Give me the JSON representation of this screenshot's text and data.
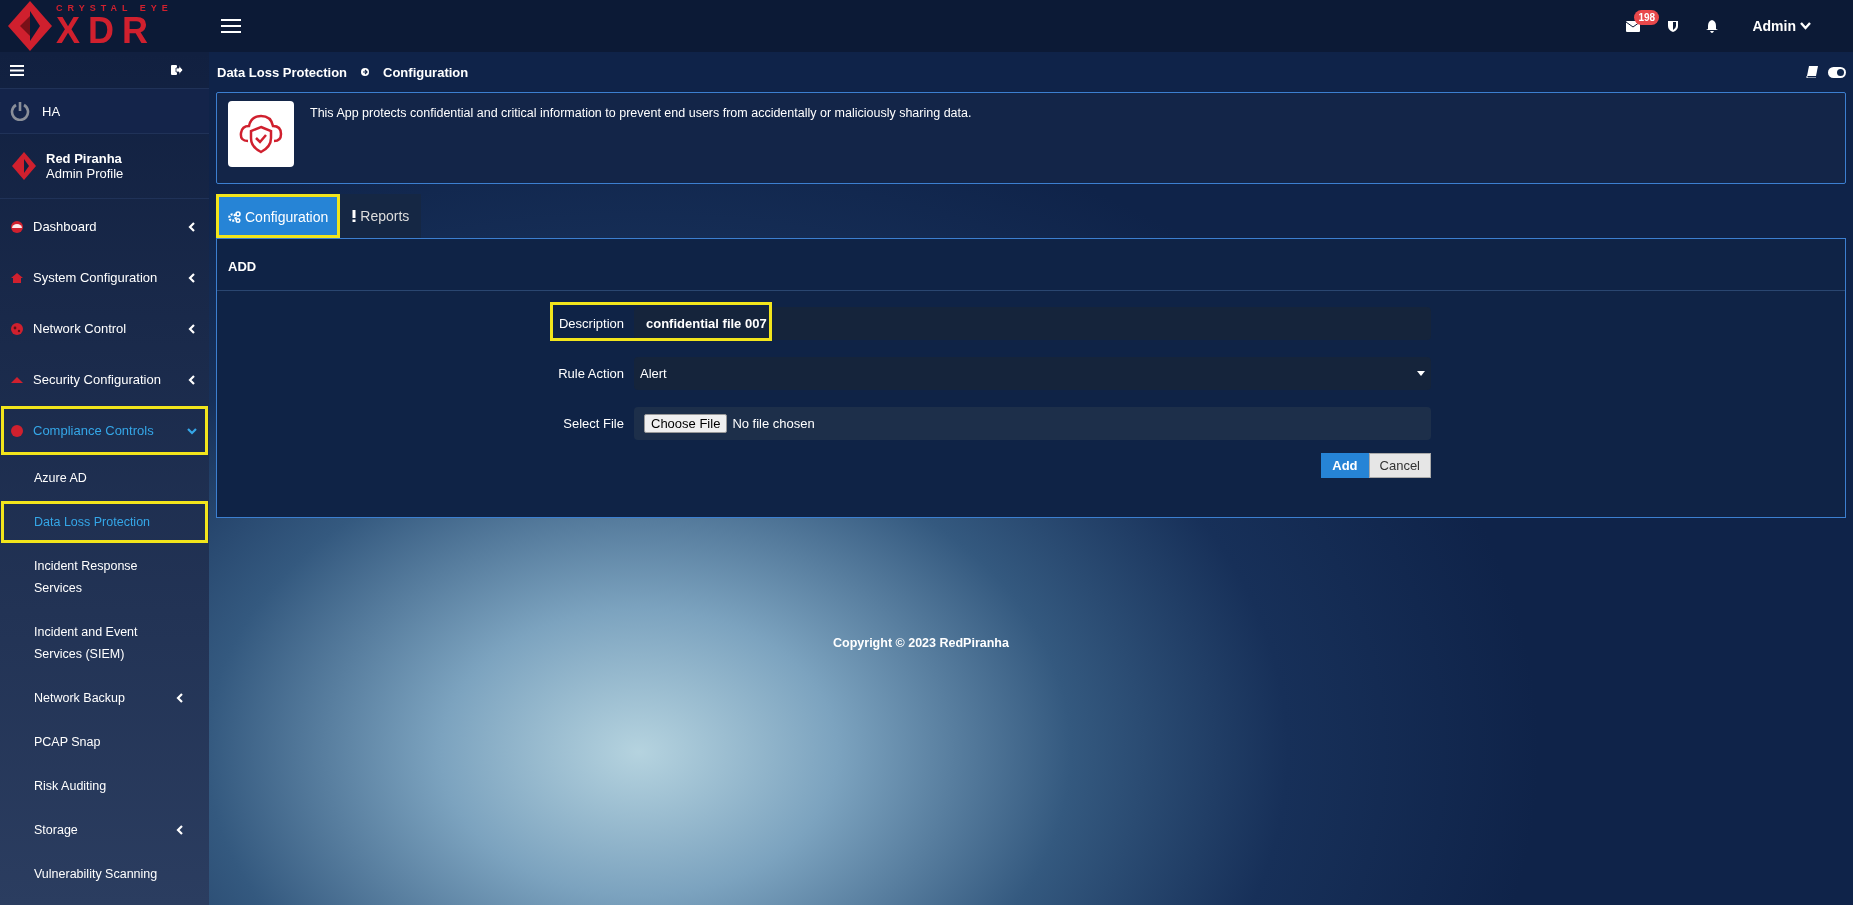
{
  "header": {
    "logo_top": "CRYSTAL EYE",
    "logo_main": "XDR",
    "mail_badge": "198",
    "user": "Admin"
  },
  "sidebar": {
    "ha_label": "HA",
    "profile": {
      "name": "Red Piranha",
      "role": "Admin Profile"
    },
    "items": [
      {
        "label": "Dashboard",
        "kind": "group",
        "expanded": false,
        "highlighted": false
      },
      {
        "label": "System Configuration",
        "kind": "group",
        "expanded": false,
        "highlighted": false
      },
      {
        "label": "Network Control",
        "kind": "group",
        "expanded": false,
        "highlighted": false
      },
      {
        "label": "Security Configuration",
        "kind": "group",
        "expanded": false,
        "highlighted": false
      },
      {
        "label": "Compliance Controls",
        "kind": "group",
        "expanded": true,
        "highlighted": true,
        "children": [
          {
            "label": "Azure AD",
            "kind": "link",
            "selected": false,
            "highlighted": false
          },
          {
            "label": "Data Loss Protection",
            "kind": "link",
            "selected": true,
            "highlighted": true
          },
          {
            "label": "Incident Response Services",
            "kind": "link",
            "selected": false,
            "highlighted": false
          },
          {
            "label": "Incident and Event Services (SIEM)",
            "kind": "link",
            "selected": false,
            "highlighted": false
          },
          {
            "label": "Network Backup",
            "kind": "group",
            "expanded": false,
            "highlighted": false
          },
          {
            "label": "PCAP Snap",
            "kind": "link",
            "selected": false,
            "highlighted": false
          },
          {
            "label": "Risk Auditing",
            "kind": "link",
            "selected": false,
            "highlighted": false
          },
          {
            "label": "Storage",
            "kind": "group",
            "expanded": false,
            "highlighted": false
          },
          {
            "label": "Vulnerability Scanning",
            "kind": "link",
            "selected": false,
            "highlighted": false
          }
        ]
      }
    ]
  },
  "breadcrumb": [
    "Data Loss Protection",
    "Configuration"
  ],
  "banner": {
    "text": "This App protects confidential and critical information to prevent end users from accidentally or maliciously sharing data."
  },
  "tabs": [
    {
      "label": "Configuration",
      "selected": true,
      "highlighted": true
    },
    {
      "label": "Reports",
      "selected": false,
      "highlighted": false
    }
  ],
  "panel": {
    "title": "ADD",
    "fields": [
      {
        "label": "Description",
        "kind": "text",
        "value": "confidential file 007",
        "highlighted": true
      },
      {
        "label": "Rule Action",
        "kind": "select",
        "value": "Alert"
      },
      {
        "label": "Select File",
        "kind": "file",
        "button": "Choose File",
        "value": "No file chosen"
      }
    ],
    "buttons": [
      {
        "label": "Add",
        "kind": "primary"
      },
      {
        "label": "Cancel",
        "kind": "default"
      }
    ]
  },
  "footer": "Copyright © 2023 RedPiranha"
}
